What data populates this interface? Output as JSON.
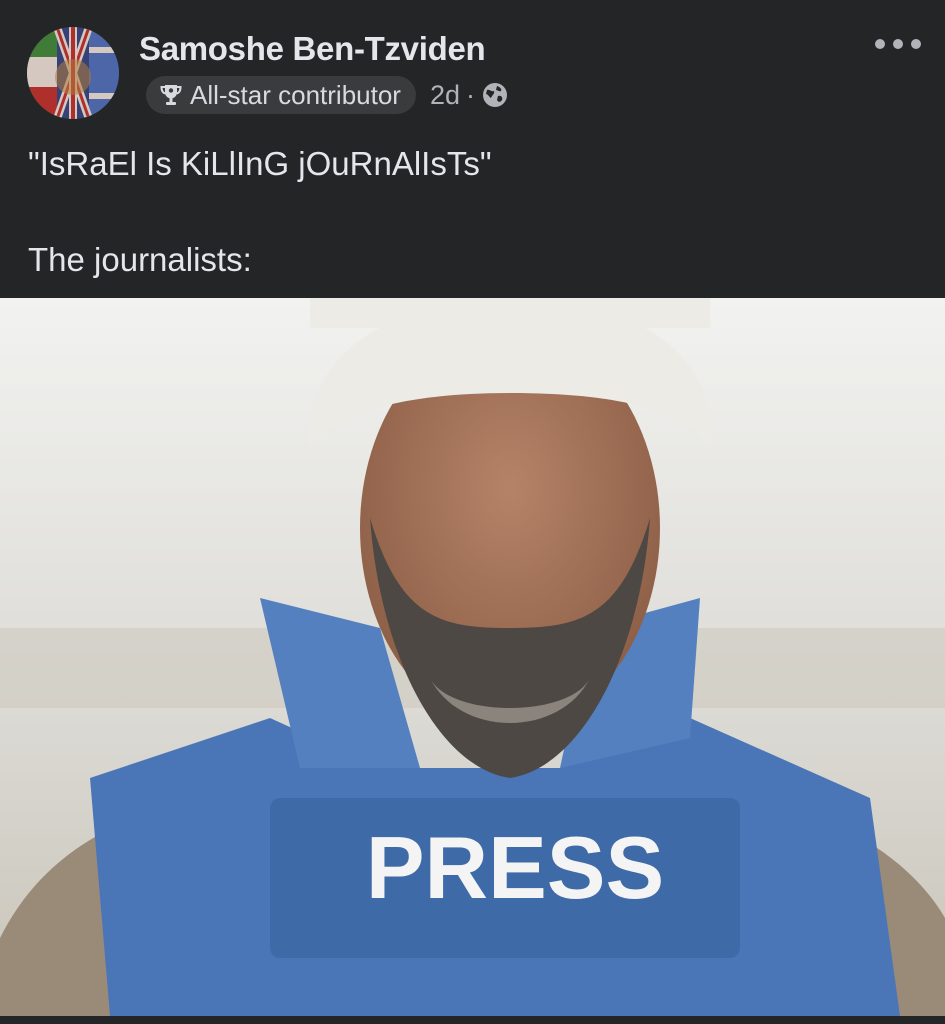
{
  "post": {
    "author_name": "Samoshe Ben-Tzviden",
    "badge": {
      "icon": "trophy-icon",
      "label": "All-star contributor"
    },
    "timestamp": "2d",
    "separator": "·",
    "audience_icon": "globe-icon",
    "more_icon": "more-horizontal-icon",
    "text_line_1": "\"IsRaEl Is KiLlInG jOuRnAlIsTs\"",
    "text_line_2": "The journalists:",
    "photo": {
      "caption_text": "PRESS"
    }
  },
  "colors": {
    "background": "#242526",
    "primary_text": "#e4e6eb",
    "secondary_text": "#b0b3b8",
    "badge_bg": "#3a3b3c",
    "vest_blue": "#4a76b8"
  }
}
